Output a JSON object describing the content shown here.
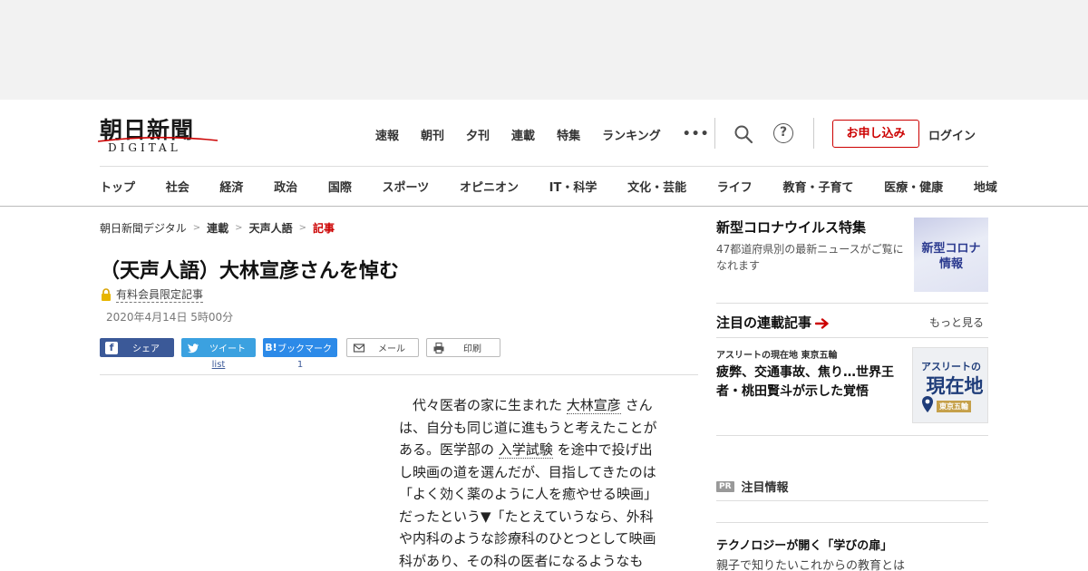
{
  "header": {
    "logo_main": "朝日新聞",
    "logo_sub": "DIGITAL",
    "nav": [
      "速報",
      "朝刊",
      "夕刊",
      "連載",
      "特集",
      "ランキング"
    ],
    "more": "•••",
    "signup_label": "お申し込み",
    "login_label": "ログイン",
    "help_symbol": "?"
  },
  "categories": [
    "トップ",
    "社会",
    "経済",
    "政治",
    "国際",
    "スポーツ",
    "オピニオン",
    "IT・科学",
    "文化・芸能",
    "ライフ",
    "教育・子育て",
    "医療・健康",
    "地域"
  ],
  "breadcrumb": [
    "朝日新聞デジタル",
    "連載",
    "天声人語",
    "記事"
  ],
  "breadcrumb_separator": ">",
  "article": {
    "title": "（天声人語）大林宣彦さんを悼む",
    "paid_label": "有料会員限定記事",
    "date": "2020年4月14日 5時00分",
    "body_lines": [
      {
        "pre": "　代々医者の家に生まれた ",
        "kw": "大林宣彦",
        "post": " さん"
      },
      {
        "pre": "は、自分も同じ道に進もうと考えたことが",
        "kw": "",
        "post": ""
      },
      {
        "pre": "ある。医学部の ",
        "kw": "入学試験",
        "post": " を途中で投げ出"
      },
      {
        "pre": "し映画の道を選んだが、目指してきたのは",
        "kw": "",
        "post": ""
      },
      {
        "pre": "「よく効く薬のように人を癒やせる映画」",
        "kw": "",
        "post": ""
      },
      {
        "pre": "だったという▼「たとえていうなら、外科",
        "kw": "",
        "post": ""
      },
      {
        "pre": "や内科のような診療科のひとつとして映画",
        "kw": "",
        "post": ""
      },
      {
        "pre": "科があり、その科の医者になるようなも",
        "kw": "",
        "post": ""
      }
    ]
  },
  "share": {
    "facebook": "シェア",
    "twitter": "ツイート",
    "twitter_count": "list",
    "hatena": "ブックマーク",
    "hatena_count": "1",
    "mail": "メール",
    "print": "印刷"
  },
  "sidebar": {
    "corona_title": "新型コロナウイルス特集",
    "corona_desc": "47都道府県別の最新ニュースがご覧になれます",
    "corona_thumb_line1": "新型コロナ",
    "corona_thumb_line2": "情報",
    "serial_heading": "注目の連載記事",
    "see_more": "もっと見る",
    "serial_kicker": "アスリートの現在地 東京五輪",
    "serial_title": "疲弊、交通事故、焦り…世界王者・桃田賢斗が示した覚悟",
    "athlete_thumb_line1": "アスリートの",
    "athlete_thumb_line2": "現在地",
    "athlete_thumb_line3": "東京五輪",
    "pr_badge": "PR",
    "pr_label": "注目情報",
    "tech_title": "テクノロジーが開く「学びの扉」",
    "tech_sub": "親子で知りたいこれからの教育とは"
  },
  "colors": {
    "brand_red": "#cc0000",
    "facebook": "#3b5998",
    "twitter": "#3ba1e0",
    "hatena": "#2c8ae8"
  }
}
